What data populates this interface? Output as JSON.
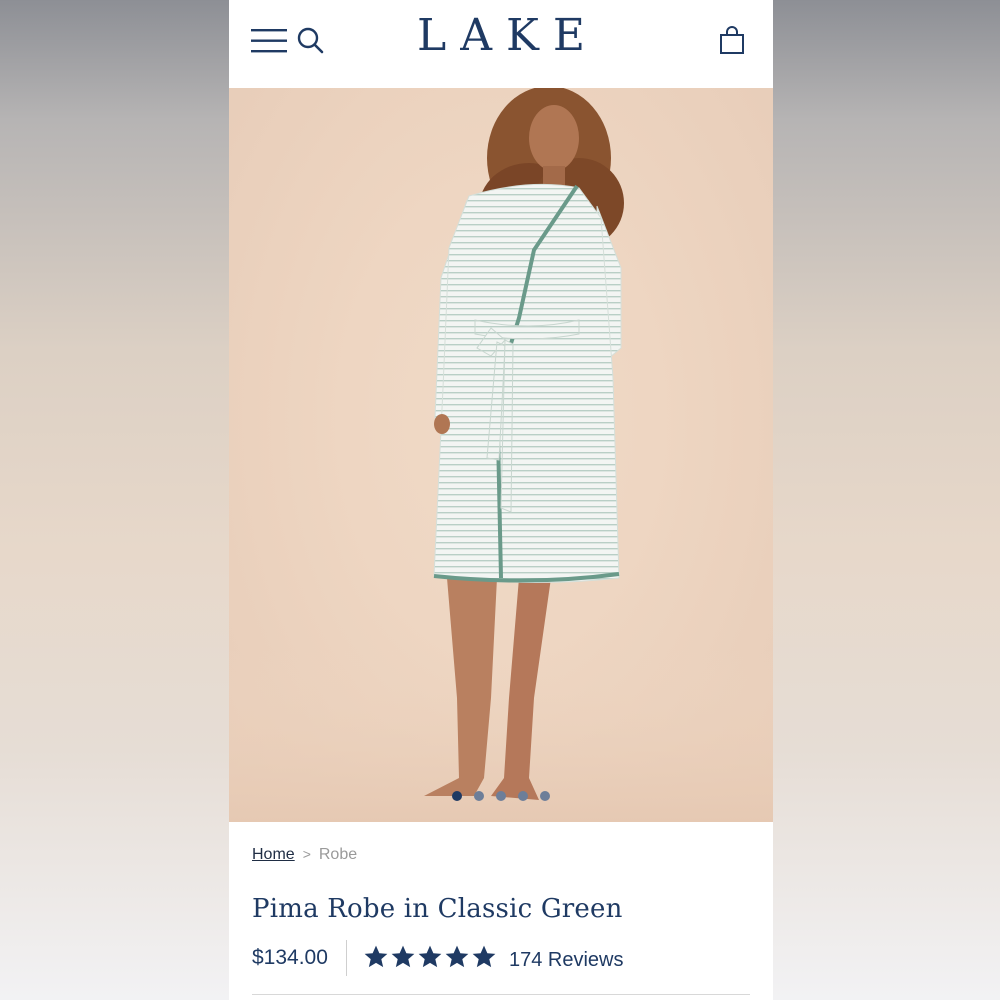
{
  "header": {
    "logo": "LAKE",
    "icons": [
      "menu-icon",
      "search-icon",
      "shopping-bag-icon"
    ]
  },
  "hero": {
    "image_description": "product-photo",
    "carousel_dots": 5,
    "active_dot_index": 0
  },
  "breadcrumb": {
    "home": "Home",
    "separator": ">",
    "current": "Robe"
  },
  "product": {
    "title": "Pima Robe in Classic Green",
    "price": "$134.00",
    "rating": 5,
    "rating_max": 5,
    "reviews": "174 Reviews"
  },
  "colors": {
    "brand_navy": "#1f3a63",
    "background": "#ffffff",
    "hero_bg": "#eed6c2",
    "robe_trim": "#6a9a8a"
  }
}
